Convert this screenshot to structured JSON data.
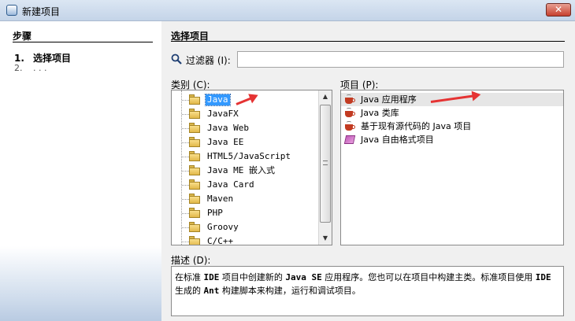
{
  "window": {
    "title": "新建项目",
    "close_label": "✕"
  },
  "steps": {
    "heading": "步骤",
    "items": [
      {
        "num": "1.",
        "label": "选择项目"
      },
      {
        "num": "2.",
        "label": ". . ."
      }
    ]
  },
  "main": {
    "heading": "选择项目",
    "filter_label": "过滤器 (I):",
    "filter_value": "",
    "categories_label": "类别 (C):",
    "projects_label": "项目 (P):",
    "description_label": "描述 (D):"
  },
  "categories": [
    {
      "label": "Java",
      "selected": true
    },
    {
      "label": "JavaFX"
    },
    {
      "label": "Java Web"
    },
    {
      "label": "Java EE"
    },
    {
      "label": "HTML5/JavaScript"
    },
    {
      "label": "Java ME 嵌入式"
    },
    {
      "label": "Java Card"
    },
    {
      "label": "Maven"
    },
    {
      "label": "PHP"
    },
    {
      "label": "Groovy"
    },
    {
      "label": "C/C++"
    }
  ],
  "projects": [
    {
      "label": "Java 应用程序",
      "icon": "java-cup-icon",
      "selected": true
    },
    {
      "label": "Java 类库",
      "icon": "java-cup-icon"
    },
    {
      "label": "基于现有源代码的 Java 项目",
      "icon": "java-cup-icon"
    },
    {
      "label": "Java 自由格式项目",
      "icon": "freeform-project-icon"
    }
  ],
  "description": {
    "p1": "在标准 ",
    "b1": "IDE",
    "p2": " 项目中创建新的 ",
    "b2": "Java SE",
    "p3": " 应用程序。您也可以在项目中构建主类。标准项目使用 ",
    "b3": "IDE",
    "p4": " 生成的 ",
    "b4": "Ant",
    "p5": " 构建脚本来构建，运行和调试项目。"
  },
  "colors": {
    "selection": "#3399ff",
    "annotation_arrow": "#e53333"
  }
}
